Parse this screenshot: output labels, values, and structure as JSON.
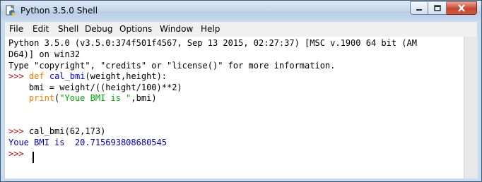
{
  "window": {
    "title": "Python 3.5.0 Shell"
  },
  "menu": [
    "File",
    "Edit",
    "Shell",
    "Debug",
    "Options",
    "Window",
    "Help"
  ],
  "shell": {
    "banner_1": "Python 3.5.0 (v3.5.0:374f501f4567, Sep 13 2015, 02:27:37) [MSC v.1900 64 bit (AM",
    "banner_2": "D64)] on win32",
    "banner_3": "Type \"copyright\", \"credits\" or \"license()\" for more information.",
    "prompt": ">>>",
    "def_keyword": "def",
    "def_name": "cal_bmi",
    "def_rest": "(weight,height):",
    "body_1": "    bmi = weight/((height/100)**2)",
    "body_2_indent": "    ",
    "body_2_print": "print",
    "body_2_open": "(",
    "body_2_string": "\"Youe BMI is \"",
    "body_2_rest": ",bmi)",
    "call": "cal_bmi(62,173)",
    "output": "Youe BMI is  20.715693808680545"
  },
  "icons": {
    "app": "python-idle-icon",
    "minimize": "minimize-icon",
    "maximize": "maximize-icon",
    "close": "close-icon"
  },
  "colors": {
    "keyword": "#ff7700",
    "function_name": "#0000ff",
    "string": "#00aa00",
    "prompt": "#c00000",
    "output": "#0000c0"
  }
}
